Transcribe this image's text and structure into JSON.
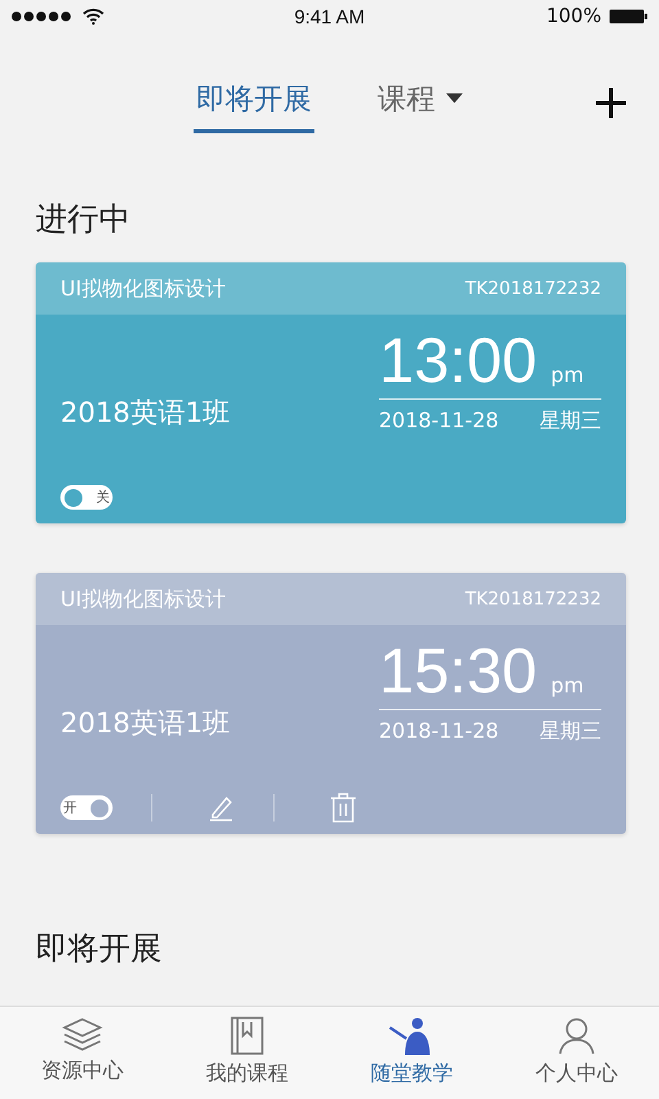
{
  "status_bar": {
    "time": "9:41 AM",
    "battery": "100%"
  },
  "header": {
    "tabs": [
      {
        "label": "即将开展",
        "selected": true,
        "dropdown": false
      },
      {
        "label": "课程",
        "selected": false,
        "dropdown": true
      }
    ]
  },
  "sections": [
    {
      "title": "进行中",
      "cards": [
        {
          "course": "UI拟物化图标设计",
          "code": "TK2018172232",
          "class_name": "2018英语1班",
          "time": "13:00",
          "period": "pm",
          "date": "2018-11-28",
          "weekday": "星期三",
          "color": "#4aaac4",
          "on": false,
          "toggle_label": "关",
          "editable": false
        },
        {
          "course": "UI拟物化图标设计",
          "code": "TK2018172232",
          "class_name": "2018英语1班",
          "time": "15:30",
          "period": "pm",
          "date": "2018-11-28",
          "weekday": "星期三",
          "color": "#a2afc9",
          "on": true,
          "toggle_label": "开",
          "editable": true
        }
      ]
    },
    {
      "title": "即将开展"
    }
  ],
  "tab_bar": [
    {
      "label": "资源中心",
      "kind": "layers",
      "selected": false
    },
    {
      "label": "我的课程",
      "kind": "book",
      "selected": false
    },
    {
      "label": "随堂教学",
      "kind": "teach",
      "selected": true
    },
    {
      "label": "个人中心",
      "kind": "person",
      "selected": false
    }
  ]
}
